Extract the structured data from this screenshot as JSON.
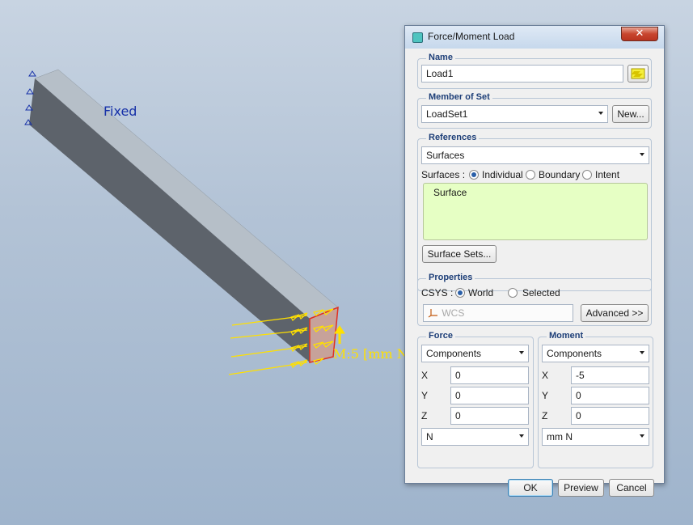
{
  "viewport": {
    "constraint_label": "Fixed",
    "load_label": "M:5 [mm N"
  },
  "dialog": {
    "title": "Force/Moment Load",
    "close_glyph": "✕",
    "name": {
      "legend": "Name",
      "value": "Load1"
    },
    "member_of_set": {
      "legend": "Member of Set",
      "selected": "LoadSet1",
      "new_label": "New..."
    },
    "references": {
      "legend": "References",
      "type_selected": "Surfaces",
      "surfaces_label": "Surfaces :",
      "options": [
        {
          "label": "Individual",
          "selected": true
        },
        {
          "label": "Boundary",
          "selected": false
        },
        {
          "label": "Intent",
          "selected": false
        }
      ],
      "items": [
        "Surface"
      ],
      "surface_sets_label": "Surface Sets..."
    },
    "properties": {
      "legend": "Properties",
      "csys_label": "CSYS :",
      "options": [
        {
          "label": "World",
          "selected": true
        },
        {
          "label": "Selected",
          "selected": false
        }
      ],
      "csys_field": "WCS",
      "advanced_label": "Advanced >>"
    },
    "force": {
      "legend": "Force",
      "mode": "Components",
      "x_label": "X",
      "x": "0",
      "y_label": "Y",
      "y": "0",
      "z_label": "Z",
      "z": "0",
      "units": "N"
    },
    "moment": {
      "legend": "Moment",
      "mode": "Components",
      "x_label": "X",
      "x": "-5",
      "y_label": "Y",
      "y": "0",
      "z_label": "Z",
      "z": "0",
      "units": "mm N"
    },
    "buttons": {
      "ok": "OK",
      "preview": "Preview",
      "cancel": "Cancel"
    }
  },
  "colors": {
    "load_arrow": "#ffe000",
    "selection_outline": "#e03020",
    "beam_top": "#b6bfc8",
    "beam_side": "#5d636b",
    "constraint": "#1630a8",
    "accent_blue": "#1e3f78",
    "highlight_list": "#e6ffc4"
  },
  "icons": {
    "dialog": "dialog-app-icon",
    "name_picker": "color-picker-icon",
    "csys": "csys-icon"
  }
}
